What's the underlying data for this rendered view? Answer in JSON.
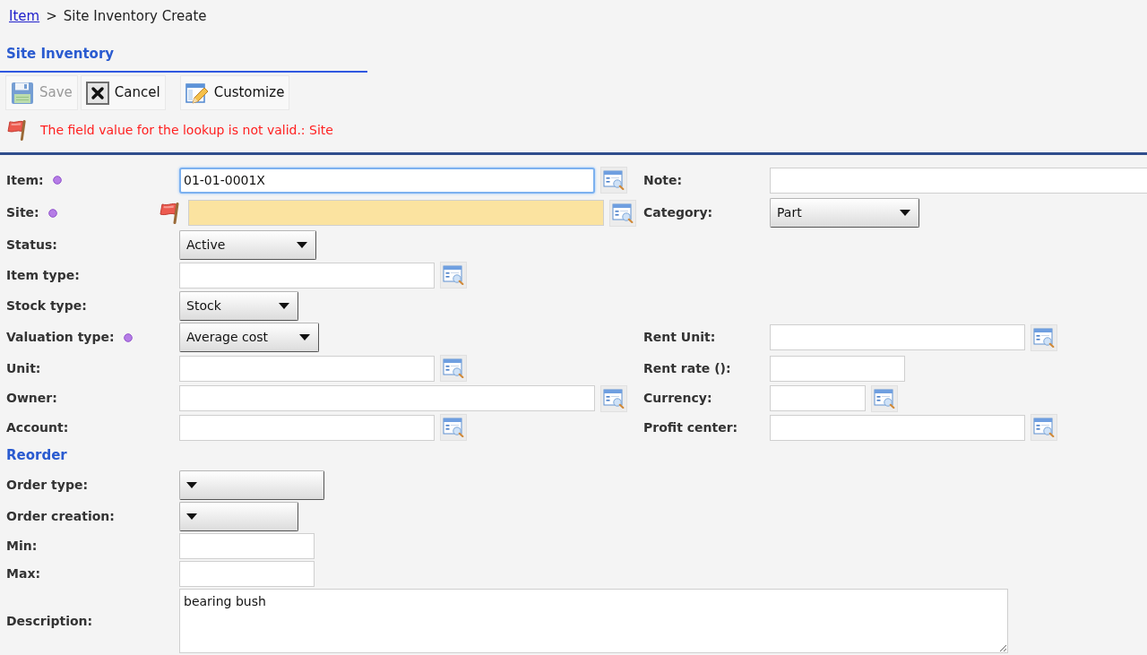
{
  "breadcrumb": {
    "link": "Item",
    "separator": ">",
    "current": "Site Inventory Create"
  },
  "section_title": "Site Inventory",
  "toolbar": [
    {
      "label": "Save",
      "kind": "save",
      "disabled": true
    },
    {
      "label": "Cancel",
      "kind": "cancel",
      "disabled": false
    },
    {
      "label": "Customize",
      "kind": "customize",
      "disabled": false
    }
  ],
  "error_message": "The field value for the lookup is not valid.: Site",
  "rows": [
    {
      "kind": "fields",
      "left": {
        "label": "Item:",
        "kind": "lookup",
        "value": "01-01-0001X",
        "required": true,
        "error": false,
        "focused": true
      },
      "right": {
        "label": "Note:",
        "kind": "text",
        "required": false,
        "error": false,
        "focused": false
      }
    },
    {
      "kind": "fields",
      "left": {
        "label": "Site:",
        "kind": "lookup",
        "required": true,
        "error": true,
        "focused": false
      },
      "right": {
        "label": "Category:",
        "kind": "select",
        "value": "Part",
        "required": false,
        "error": false,
        "focused": false
      }
    },
    {
      "kind": "fields",
      "left": {
        "label": "Status:",
        "kind": "select",
        "value": "Active",
        "required": false,
        "error": false,
        "focused": false
      }
    },
    {
      "kind": "fields",
      "left": {
        "label": "Item type:",
        "kind": "lookup",
        "required": false,
        "error": false,
        "focused": false
      }
    },
    {
      "kind": "fields",
      "left": {
        "label": "Stock type:",
        "kind": "select",
        "value": "Stock",
        "required": false,
        "error": false,
        "focused": false
      }
    },
    {
      "kind": "fields",
      "left": {
        "label": "Valuation type:",
        "kind": "select",
        "value": "Average cost",
        "required": true,
        "error": false,
        "focused": false
      },
      "right": {
        "label": "Rent Unit:",
        "kind": "lookup",
        "required": false,
        "error": false,
        "focused": false
      }
    },
    {
      "kind": "fields",
      "left": {
        "label": "Unit:",
        "kind": "lookup",
        "required": false,
        "error": false,
        "focused": false
      },
      "right": {
        "label": "Rent rate ():",
        "kind": "text",
        "required": false,
        "error": false,
        "focused": false
      }
    },
    {
      "kind": "fields",
      "left": {
        "label": "Owner:",
        "kind": "lookup",
        "required": false,
        "error": false,
        "focused": false
      },
      "right": {
        "label": "Currency:",
        "kind": "lookup",
        "required": false,
        "error": false,
        "focused": false
      }
    },
    {
      "kind": "fields",
      "left": {
        "label": "Account:",
        "kind": "lookup",
        "required": false,
        "error": false,
        "focused": false
      },
      "right": {
        "label": "Profit center:",
        "kind": "lookup",
        "required": false,
        "error": false,
        "focused": false
      }
    },
    {
      "kind": "section",
      "title": "Reorder"
    },
    {
      "kind": "fields",
      "left": {
        "label": "Order type:",
        "kind": "select",
        "required": false,
        "error": false,
        "focused": false
      }
    },
    {
      "kind": "fields",
      "left": {
        "label": "Order creation:",
        "kind": "select",
        "required": false,
        "error": false,
        "focused": false
      }
    },
    {
      "kind": "fields",
      "left": {
        "label": "Min:",
        "kind": "text",
        "required": false,
        "error": false,
        "focused": false
      }
    },
    {
      "kind": "fields",
      "left": {
        "label": "Max:",
        "kind": "text",
        "required": false,
        "error": false,
        "focused": false
      }
    },
    {
      "kind": "fields",
      "left": {
        "label": "Description:",
        "kind": "textarea",
        "value": "bearing bush",
        "required": false,
        "error": false,
        "focused": false
      }
    }
  ]
}
